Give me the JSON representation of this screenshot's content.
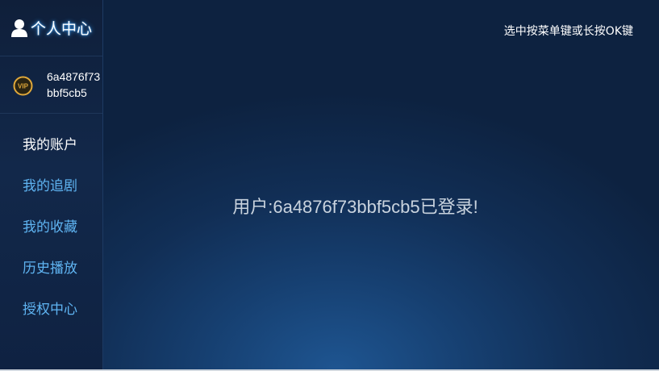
{
  "sidebar": {
    "title": "个人中心",
    "title_icon": "user-icon",
    "account": {
      "badge_icon": "vip-badge-icon",
      "badge_text": "VIP",
      "user_id": "6a4876f73bbf5cb5"
    },
    "menu": [
      {
        "label": "我的账户",
        "active": true
      },
      {
        "label": "我的追剧",
        "active": false
      },
      {
        "label": "我的收藏",
        "active": false
      },
      {
        "label": "历史播放",
        "active": false
      },
      {
        "label": "授权中心",
        "active": false
      }
    ]
  },
  "main": {
    "hint": "选中按菜单键或长按OK键",
    "status_message": "用户:6a4876f73bbf5cb5已登录!"
  },
  "colors": {
    "menu_text": "#5fb4f2",
    "menu_active_text": "#ffffff",
    "title_glow": "#3aa0ff",
    "vip_gold": "#e0a83a"
  }
}
